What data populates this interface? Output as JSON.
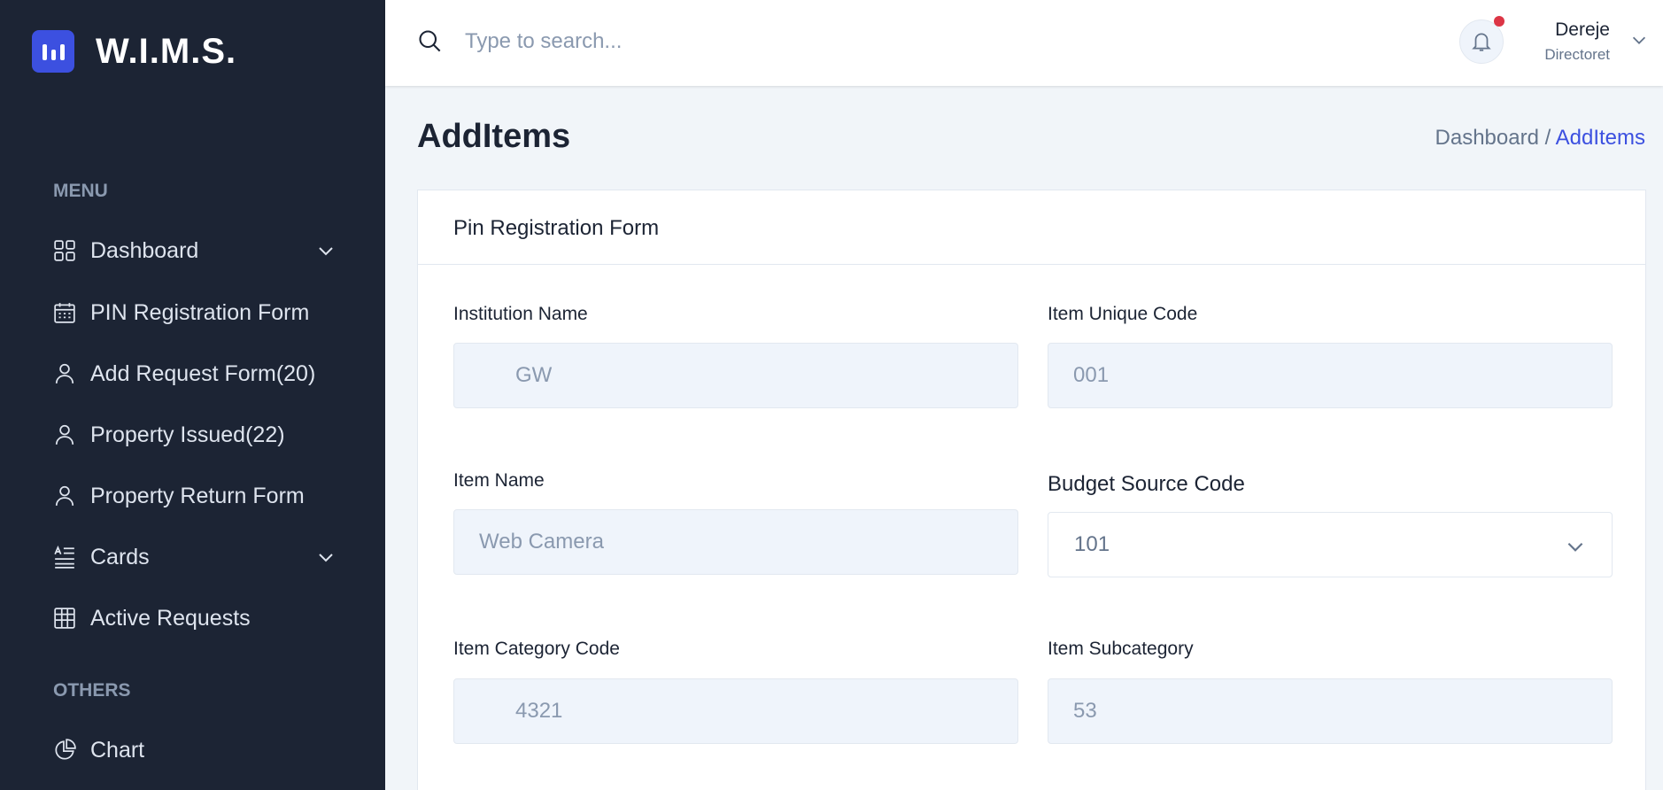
{
  "app": {
    "title": "W.I.M.S."
  },
  "sidebar": {
    "menu_heading": "MENU",
    "others_heading": "OTHERS",
    "items": [
      {
        "label": "Dashboard",
        "icon": "grid-icon",
        "has_submenu": true
      },
      {
        "label": "PIN Registration Form",
        "icon": "calendar-icon",
        "has_submenu": false
      },
      {
        "label": "Add Request Form(20)",
        "icon": "user-icon",
        "has_submenu": false
      },
      {
        "label": "Property Issued(22)",
        "icon": "user-icon",
        "has_submenu": false
      },
      {
        "label": "Property Return Form",
        "icon": "user-icon",
        "has_submenu": false
      },
      {
        "label": "Cards",
        "icon": "text-list-icon",
        "has_submenu": true
      },
      {
        "label": "Active Requests",
        "icon": "table-icon",
        "has_submenu": false
      }
    ],
    "others": [
      {
        "label": "Chart",
        "icon": "pie-chart-icon"
      }
    ]
  },
  "header": {
    "search_placeholder": "Type to search...",
    "notification_icon": "bell-icon",
    "user": {
      "name": "Dereje",
      "role": "Directoret"
    }
  },
  "page": {
    "title": "AddItems",
    "breadcrumb": {
      "parent": "Dashboard /",
      "current": "AddItems"
    }
  },
  "form": {
    "title": "Pin Registration Form",
    "fields": {
      "institution_name": {
        "label": "Institution Name",
        "value": "GW"
      },
      "item_unique_code": {
        "label": "Item Unique Code",
        "value": "001"
      },
      "item_name": {
        "label": "Item Name",
        "value": "Web Camera"
      },
      "budget_source_code": {
        "label": "Budget Source Code",
        "value": "101"
      },
      "item_category_code": {
        "label": "Item Category Code",
        "value": "4321"
      },
      "item_subcategory": {
        "label": "Item Subcategory",
        "value": "53"
      }
    }
  },
  "colors": {
    "sidebar_bg": "#1c2434",
    "accent": "#3c50e0",
    "notification_dot": "#dc3545",
    "input_bg": "#eff4fb"
  }
}
